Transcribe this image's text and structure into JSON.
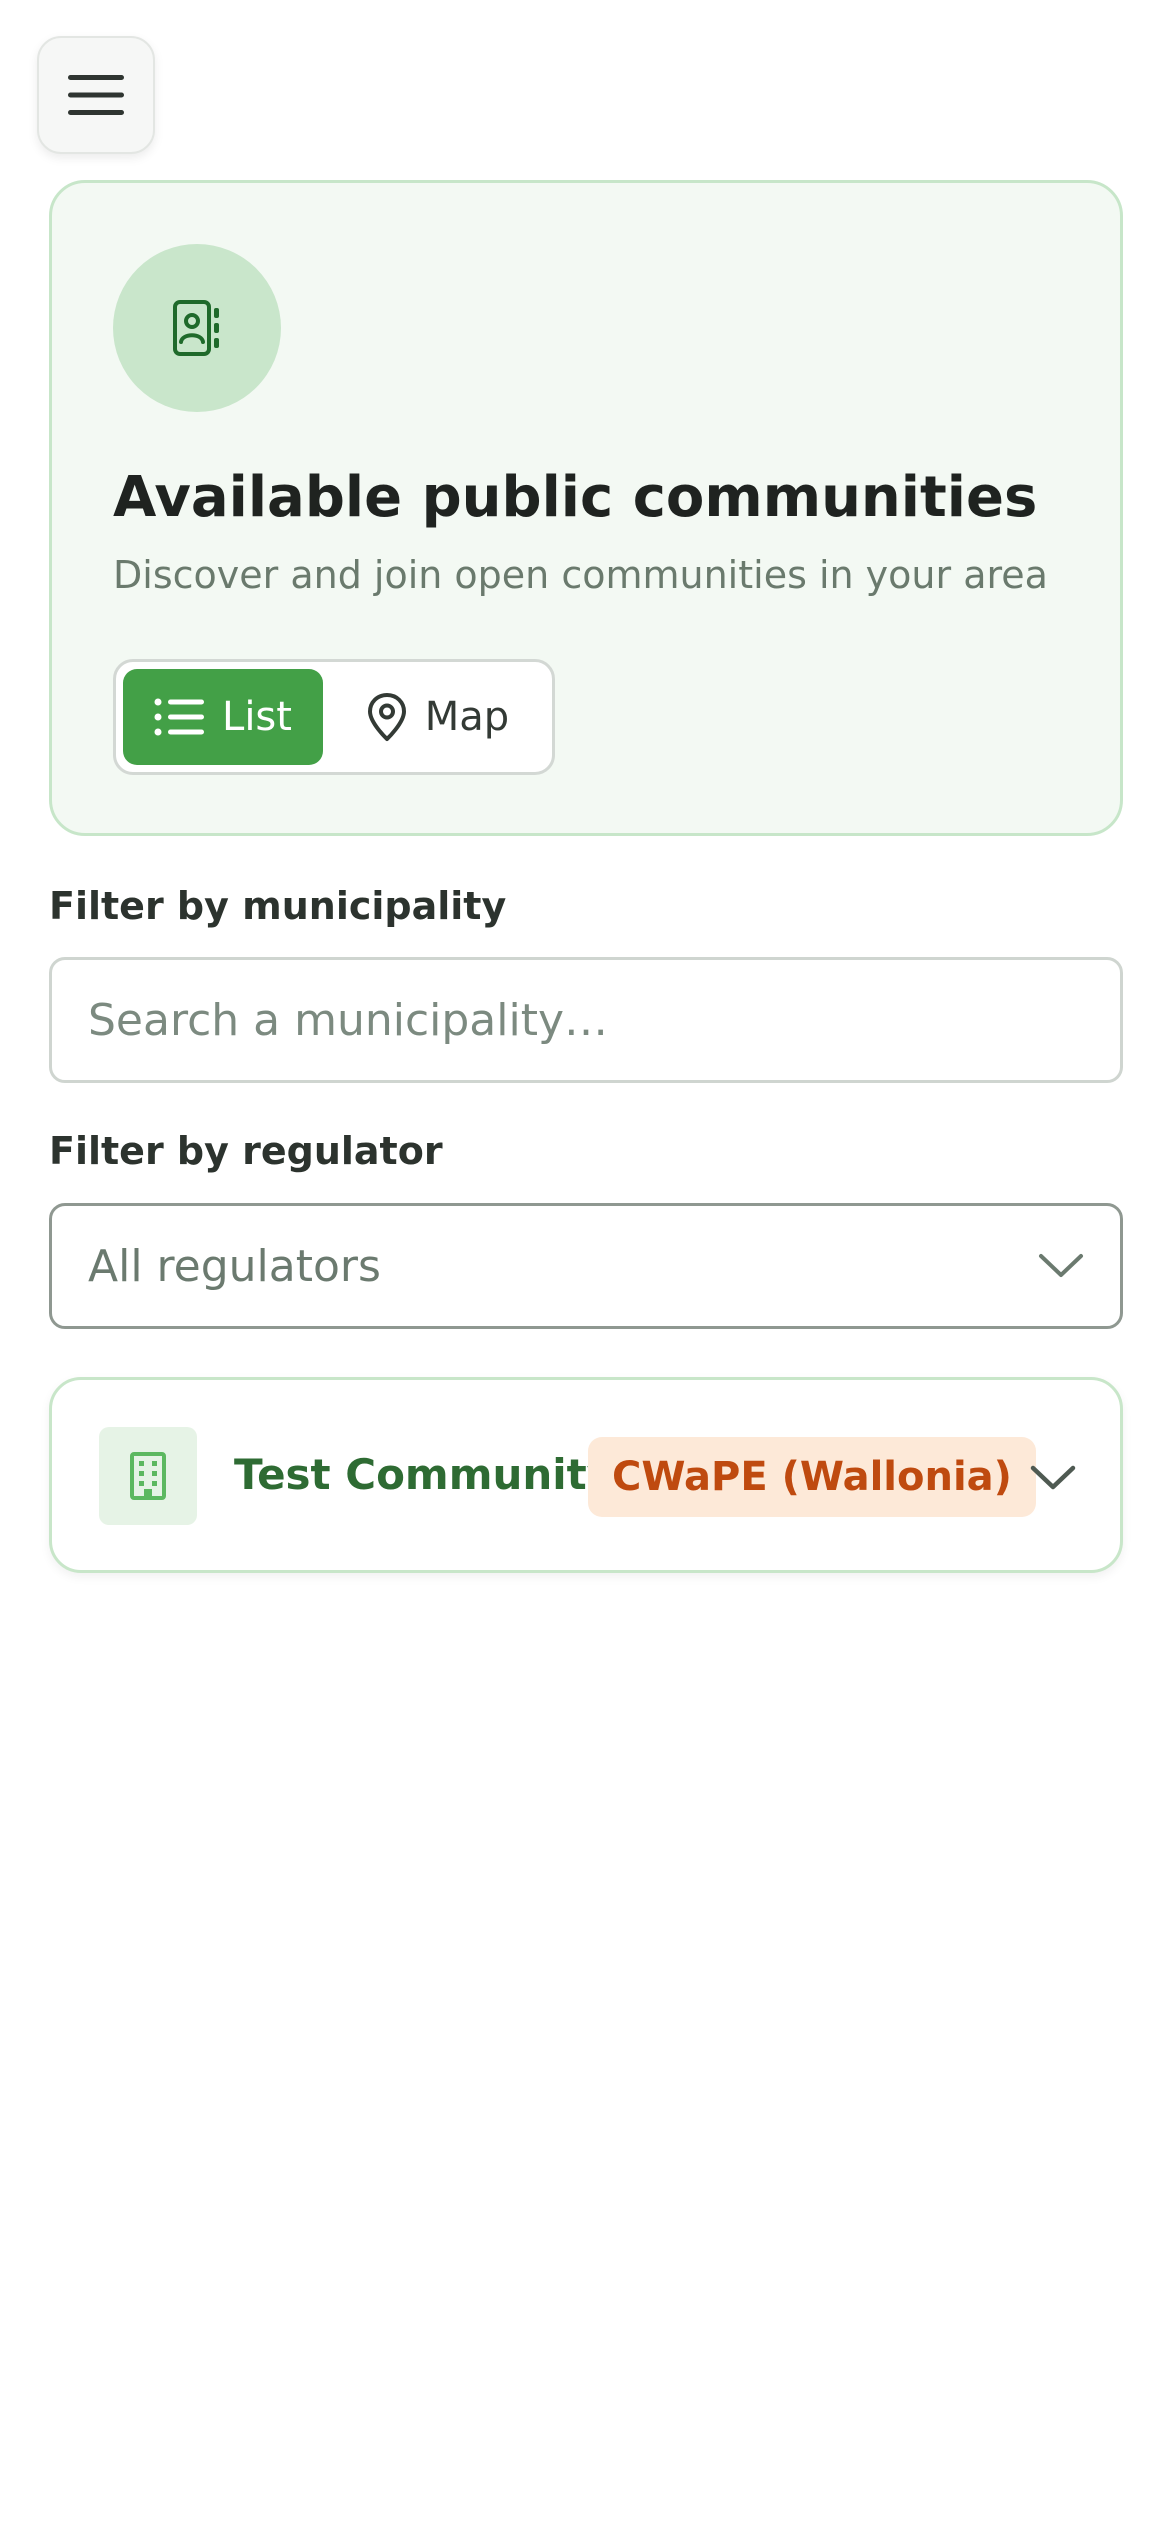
{
  "header": {
    "menu_icon": "hamburger-menu-icon"
  },
  "hero": {
    "icon": "contact-book-icon",
    "title": "Available public communities",
    "subtitle": "Discover and join open communities in your area",
    "view_toggle": {
      "list_label": "List",
      "list_icon": "list-icon",
      "map_label": "Map",
      "map_icon": "map-pin-icon",
      "active": "List"
    }
  },
  "filters": {
    "municipality": {
      "label": "Filter by municipality",
      "placeholder": "Search a municipality…",
      "value": ""
    },
    "regulator": {
      "label": "Filter by regulator",
      "selected": "All regulators",
      "icon": "chevron-down-icon"
    }
  },
  "communities": [
    {
      "name": "Test Community",
      "regulator": "CWaPE (Wallonia)",
      "icon": "building-icon",
      "expand_icon": "chevron-down-icon"
    }
  ],
  "colors": {
    "primary_green": "#43a047",
    "hero_background": "#f3f9f3",
    "hero_border": "#c7e6c9",
    "badge_background": "#fde9d8",
    "badge_text": "#bf4a0f",
    "community_name": "#2e6b33"
  }
}
